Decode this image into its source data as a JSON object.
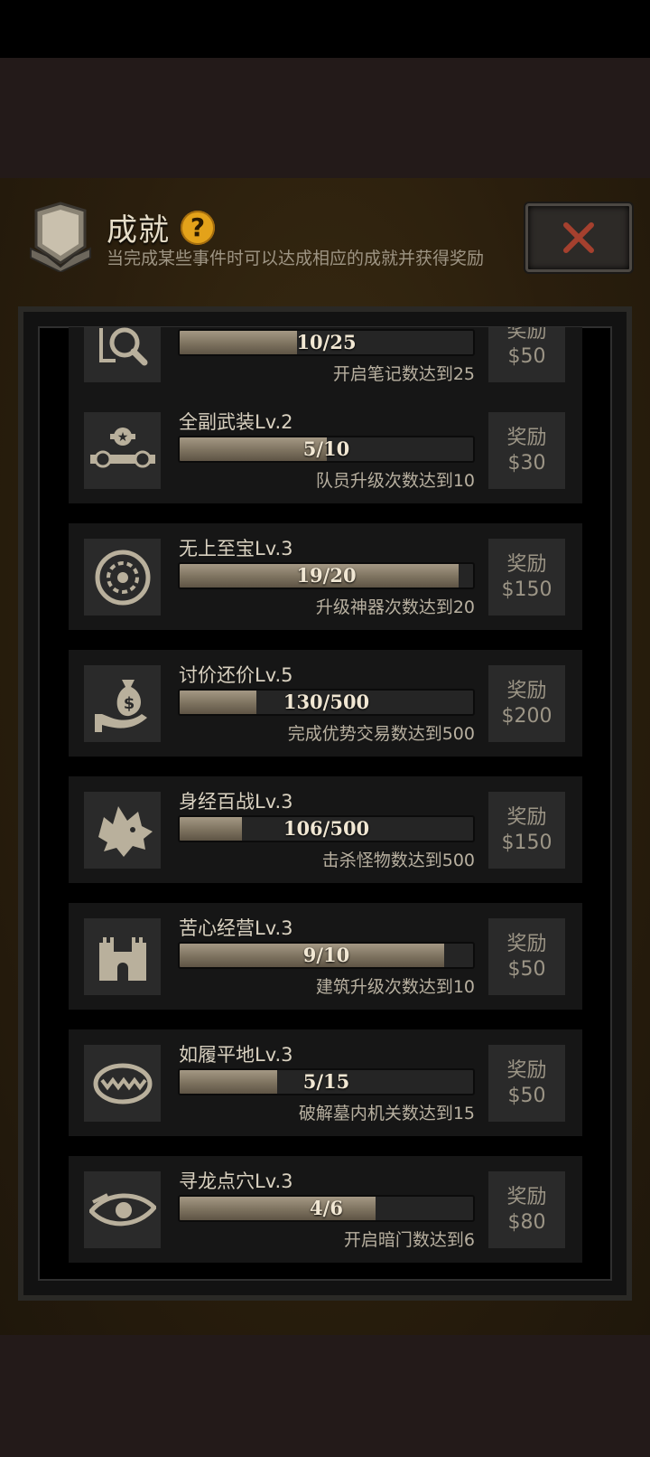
{
  "header": {
    "title": "成就",
    "subtitle": "当完成某些事件时可以达成相应的成就并获得奖励",
    "help_icon": "question-icon",
    "close_icon": "close-x-icon"
  },
  "colors": {
    "accent_gold": "#e3a21a",
    "close_x": "#a5402e",
    "progress_fill": "#8a7e6a"
  },
  "achievements": [
    {
      "name": "",
      "progress": "10/25",
      "fraction": 0.4,
      "desc": "开启笔记数达到25",
      "reward_label": "奖励",
      "reward_value": "$50",
      "icon": "search-notes-icon"
    },
    {
      "name": "全副武装Lv.2",
      "progress": "5/10",
      "fraction": 0.5,
      "desc": "队员升级次数达到10",
      "reward_label": "奖励",
      "reward_value": "$30",
      "icon": "rank-stars-icon"
    },
    {
      "name": "无上至宝Lv.3",
      "progress": "19/20",
      "fraction": 0.95,
      "desc": "升级神器次数达到20",
      "reward_label": "奖励",
      "reward_value": "$150",
      "icon": "relic-medallion-icon"
    },
    {
      "name": "讨价还价Lv.5",
      "progress": "130/500",
      "fraction": 0.26,
      "desc": "完成优势交易数达到500",
      "reward_label": "奖励",
      "reward_value": "$200",
      "icon": "money-bag-hand-icon"
    },
    {
      "name": "身经百战Lv.3",
      "progress": "106/500",
      "fraction": 0.212,
      "desc": "击杀怪物数达到500",
      "reward_label": "奖励",
      "reward_value": "$150",
      "icon": "wolf-head-icon"
    },
    {
      "name": "苦心经营Lv.3",
      "progress": "9/10",
      "fraction": 0.9,
      "desc": "建筑升级次数达到10",
      "reward_label": "奖励",
      "reward_value": "$50",
      "icon": "castle-icon"
    },
    {
      "name": "如履平地Lv.3",
      "progress": "5/15",
      "fraction": 0.333,
      "desc": "破解墓内机关数达到15",
      "reward_label": "奖励",
      "reward_value": "$50",
      "icon": "trap-jaws-icon"
    },
    {
      "name": "寻龙点穴Lv.3",
      "progress": "4/6",
      "fraction": 0.667,
      "desc": "开启暗门数达到6",
      "reward_label": "奖励",
      "reward_value": "$80",
      "icon": "dragon-eye-icon"
    }
  ]
}
